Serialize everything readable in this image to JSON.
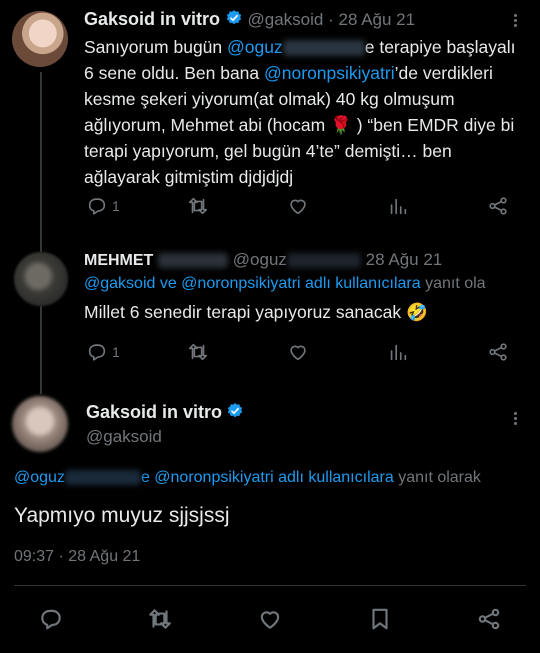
{
  "tweet1": {
    "display_name": "Gaksoid in vitro",
    "handle": "@gaksoid",
    "sep": "·",
    "date": "28 Ağu 21",
    "line1_a": "Sanıyorum bugün ",
    "line1_mention": "@oguz",
    "line1_b": "e terapiye başlayalı",
    "line2": "6 sene oldu. Ben bana ",
    "line2_mention": "@noronpsikiyatri",
    "line2_b": "’de verdikleri",
    "line3": "kesme şekeri yiyorum(at olmak) 40 kg olmuşum",
    "line4": "ağlıyorum, Mehmet abi (hocam 🌹 ) “ben EMDR diye bi",
    "line5": "terapi yapıyorum, gel bugün 4’te” demişti… ben",
    "line6": "ağlayarak gitmiştim djdjdjdj",
    "reply_count": "1"
  },
  "tweet2": {
    "display_name": "MEHMET",
    "handle": "@oguz",
    "date": "28 Ağu 21",
    "reply_line": "@gaksoid ve @noronpsikiyatri adlı kullanıcılara",
    "reply_suffix": " yanıt ola",
    "text": "Millet 6 senedir terapi yapıyoruz sanacak 🤣",
    "reply_count": "1"
  },
  "main_tweet": {
    "display_name": "Gaksoid in vitro",
    "handle": "@gaksoid",
    "reply_mention1": "@oguz",
    "reply_mid": "e @noronpsikiyatri adlı kullanıcılara",
    "reply_suffix": " yanıt olarak",
    "text": "Yapmıyo muyuz sjjsjssj",
    "timestamp": "09:37 · 28 Ağu 21"
  },
  "colors": {
    "accent": "#1d9bf0",
    "muted": "#71767b",
    "text": "#e7e9ea",
    "background": "#000000"
  },
  "icons": [
    "reply-icon",
    "retweet-icon",
    "like-icon",
    "analytics-icon",
    "share-icon",
    "bookmark-icon",
    "verified-icon",
    "more-icon"
  ]
}
